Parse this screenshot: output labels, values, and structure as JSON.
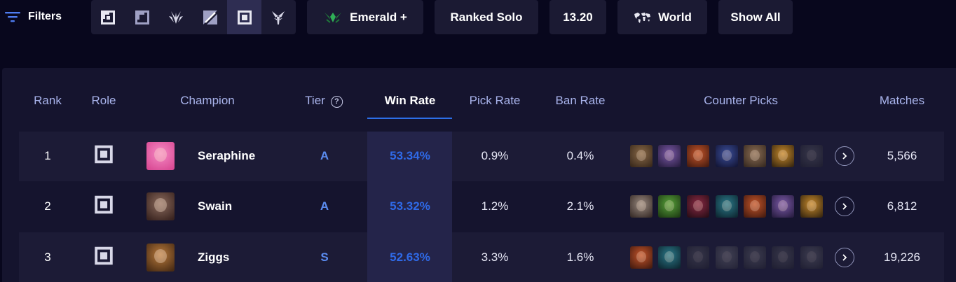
{
  "filters": {
    "label": "Filters"
  },
  "roles": [
    {
      "name": "top",
      "active": false
    },
    {
      "name": "jungle",
      "active": false
    },
    {
      "name": "mid",
      "active": false
    },
    {
      "name": "bot",
      "active": false
    },
    {
      "name": "support",
      "active": true
    },
    {
      "name": "all-roles",
      "active": false
    }
  ],
  "rank_filter": {
    "label": "Emerald +",
    "icon": "emerald-rank-icon",
    "color": "#2fae57"
  },
  "queue_filter": {
    "label": "Ranked Solo"
  },
  "patch_filter": {
    "label": "13.20"
  },
  "region_filter": {
    "label": "World",
    "icon": "world-map-icon"
  },
  "show_all": {
    "label": "Show All"
  },
  "table": {
    "headers": {
      "rank": "Rank",
      "role": "Role",
      "champion": "Champion",
      "tier": "Tier",
      "win_rate": "Win Rate",
      "pick_rate": "Pick Rate",
      "ban_rate": "Ban Rate",
      "counter_picks": "Counter Picks",
      "matches": "Matches"
    },
    "tier_help_icon": "?",
    "sorted_by": "win_rate",
    "rows": [
      {
        "rank": "1",
        "role": "support",
        "champion": "Seraphine",
        "tier": "A",
        "win_rate": "53.34%",
        "pick_rate": "0.9%",
        "ban_rate": "0.4%",
        "matches": "5,566",
        "portrait_colors": [
          "#f58ac4",
          "#d94a94"
        ],
        "counters": [
          {
            "c1": "#8a6a48",
            "c2": "#3b2a1c",
            "faded": false
          },
          {
            "c1": "#7c5aa8",
            "c2": "#2b1f44",
            "faded": false
          },
          {
            "c1": "#c4552a",
            "c2": "#4a1d10",
            "faded": false
          },
          {
            "c1": "#3c4f9a",
            "c2": "#14173a",
            "faded": false
          },
          {
            "c1": "#8b6d54",
            "c2": "#3a2c22",
            "faded": false
          },
          {
            "c1": "#c78a2c",
            "c2": "#3d2a10",
            "faded": false
          },
          {
            "c1": "#6a6a70",
            "c2": "#2a2a30",
            "faded": true
          }
        ]
      },
      {
        "rank": "2",
        "role": "support",
        "champion": "Swain",
        "tier": "A",
        "win_rate": "53.32%",
        "pick_rate": "1.2%",
        "ban_rate": "2.1%",
        "matches": "6,812",
        "portrait_colors": [
          "#8a6a5c",
          "#3a2420"
        ],
        "counters": [
          {
            "c1": "#9a8a80",
            "c2": "#3a2e2a",
            "faded": false
          },
          {
            "c1": "#5aa33c",
            "c2": "#1f3f14",
            "faded": false
          },
          {
            "c1": "#8a2a44",
            "c2": "#2c0e18",
            "faded": false
          },
          {
            "c1": "#2c7a8a",
            "c2": "#0e2a34",
            "faded": false
          },
          {
            "c1": "#c4552a",
            "c2": "#4a1d10",
            "faded": false
          },
          {
            "c1": "#7c5aa8",
            "c2": "#2b1f44",
            "faded": false
          },
          {
            "c1": "#c78a2c",
            "c2": "#3d2a10",
            "faded": false
          }
        ]
      },
      {
        "rank": "3",
        "role": "support",
        "champion": "Ziggs",
        "tier": "S",
        "win_rate": "52.63%",
        "pick_rate": "3.3%",
        "ban_rate": "1.6%",
        "matches": "19,226",
        "portrait_colors": [
          "#b87a3c",
          "#4a2c14"
        ],
        "counters": [
          {
            "c1": "#c4552a",
            "c2": "#4a1d10",
            "faded": false
          },
          {
            "c1": "#2c7a8a",
            "c2": "#0e2a34",
            "faded": false
          },
          {
            "c1": "#6a6a70",
            "c2": "#2a2a30",
            "faded": true
          },
          {
            "c1": "#8a8a90",
            "c2": "#3a3a40",
            "faded": true
          },
          {
            "c1": "#7a7a80",
            "c2": "#2e2e34",
            "faded": true
          },
          {
            "c1": "#6a6a70",
            "c2": "#2a2a30",
            "faded": true
          },
          {
            "c1": "#7a7a80",
            "c2": "#2e2e34",
            "faded": true
          }
        ]
      }
    ]
  },
  "colors": {
    "background": "#08071d",
    "panel": "#15142e",
    "accent_blue": "#2c6ee6",
    "tier_blue": "#5b8cf0",
    "header_text": "#a9b4ec"
  }
}
